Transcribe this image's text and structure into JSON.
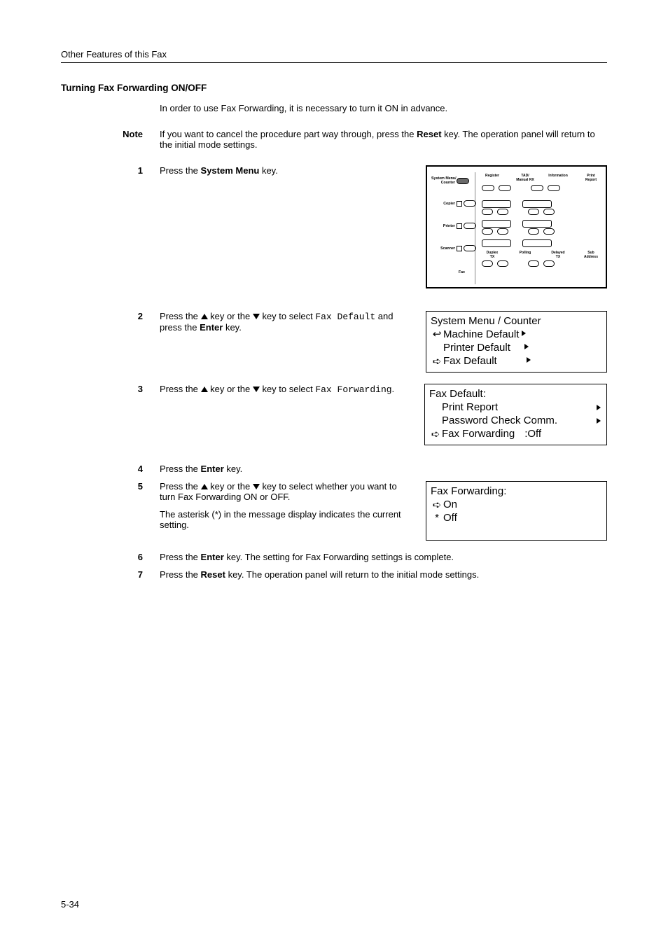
{
  "running_head": "Other Features of this Fax",
  "section_title": "Turning Fax Forwarding ON/OFF",
  "intro": "In order to use Fax Forwarding, it is necessary to turn it ON in advance.",
  "note_label": "Note",
  "note_body_a": "If you want to cancel the procedure part way through, press the ",
  "note_body_b": "Reset",
  "note_body_c": " key. The operation panel will return to the initial mode settings.",
  "steps": {
    "s1": {
      "num": "1",
      "a": "Press the ",
      "b": "System Menu",
      "c": " key."
    },
    "s2": {
      "num": "2",
      "a": "Press the ",
      "b": " key or the ",
      "c": " key to select ",
      "code": "Fax Default",
      "d": " and press the ",
      "e": "Enter",
      "f": " key."
    },
    "s3": {
      "num": "3",
      "a": "Press the ",
      "b": " key or the ",
      "c": " key to select ",
      "code": "Fax Forwarding",
      "d": "."
    },
    "s4": {
      "num": "4",
      "a": "Press the ",
      "b": "Enter",
      "c": " key."
    },
    "s5": {
      "num": "5",
      "a": "Press the ",
      "b": " key or the ",
      "c": " key to select whether you want to turn Fax Forwarding ON or OFF.",
      "p2": "The asterisk (*) in the message display indicates the current setting."
    },
    "s6": {
      "num": "6",
      "a": "Press the ",
      "b": "Enter",
      "c": " key. The setting for Fax Forwarding settings is complete."
    },
    "s7": {
      "num": "7",
      "a": "Press the ",
      "b": "Reset",
      "c": " key. The operation panel will return to the initial mode settings."
    }
  },
  "diagram": {
    "rows": {
      "sys": "System Menu/\nCounter",
      "copier": "Copier",
      "printer": "Printer",
      "scanner": "Scanner",
      "fax": "Fax"
    },
    "top_labels": {
      "reg": "Register",
      "tm": "TAD/\nManual RX",
      "info": "Information",
      "prpt": "Print\nReport"
    },
    "bottom_labels": {
      "dup": "Duplex\nTX",
      "poll": "Polling",
      "del": "Delayed\nTX",
      "sub": "Sub\nAddress"
    }
  },
  "lcd1": {
    "title": "System Menu / Counter",
    "i1": "Machine Default",
    "i2": "Printer Default",
    "i3": "Fax Default"
  },
  "lcd2": {
    "title": "Fax Default:",
    "i1": "Print Report",
    "i2": "Password Check Comm.",
    "i3": "Fax Forwarding",
    "v3": ":Off"
  },
  "lcd3": {
    "title": "Fax Forwarding:",
    "i1": "On",
    "i2": "Off"
  },
  "pgnum": "5-34"
}
